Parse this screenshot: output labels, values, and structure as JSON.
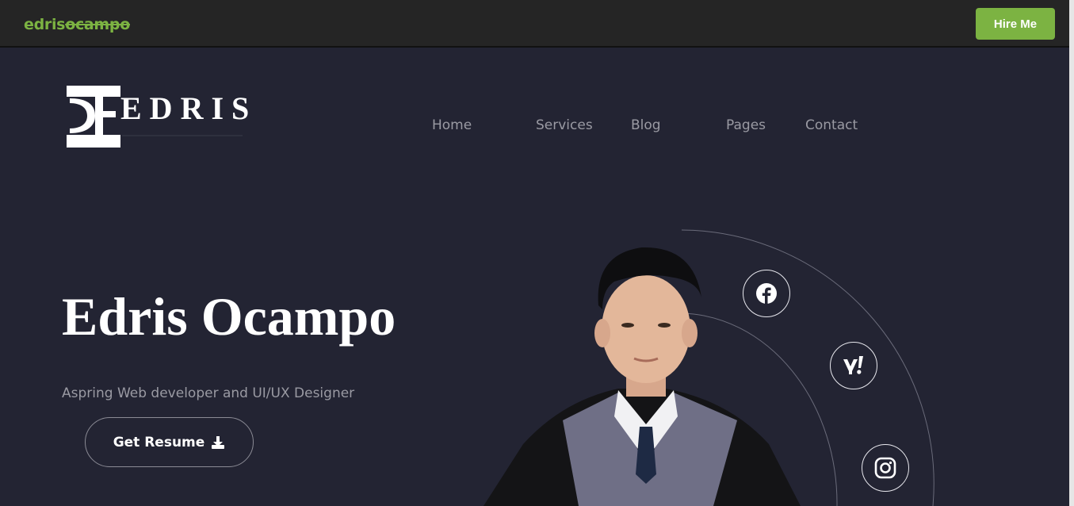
{
  "topbar": {
    "brand_prefix": "edris",
    "brand_suffix": "ocampo",
    "hire_label": "Hire Me"
  },
  "logo": {
    "letters": "EDRIS"
  },
  "nav": {
    "items": [
      "Home",
      "Services",
      "Blog",
      "Pages",
      "Contact"
    ]
  },
  "hero": {
    "name": "Edris Ocampo",
    "subtitle": "Aspring Web developer and UI/UX Designer",
    "resume_label": "Get Resume"
  },
  "social": {
    "icons": [
      "facebook-icon",
      "yahoo-icon",
      "instagram-icon"
    ]
  },
  "colors": {
    "accent": "#7cb342",
    "background": "#232433",
    "topbar": "#252525",
    "nav_text": "#9a9aa3"
  }
}
